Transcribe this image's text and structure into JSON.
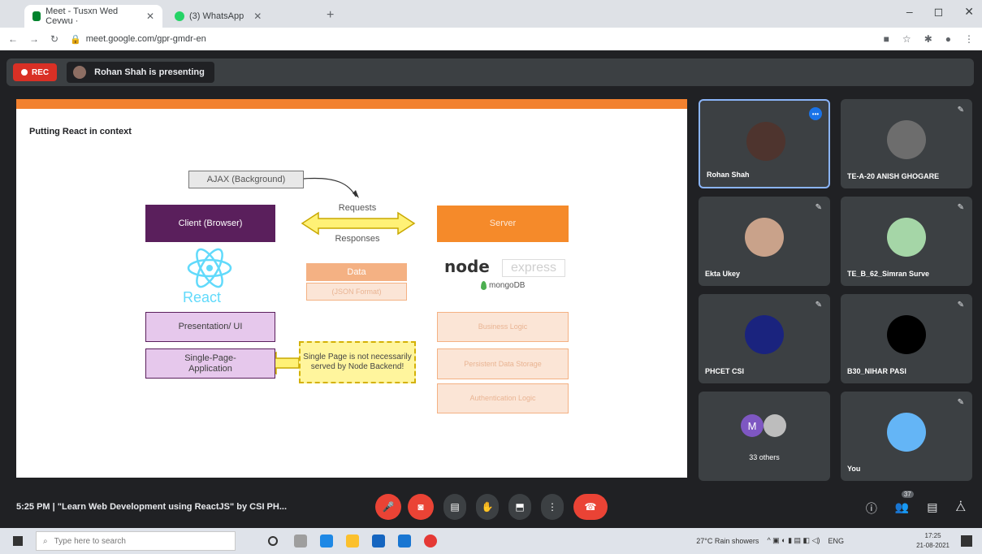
{
  "browser": {
    "tabs": [
      {
        "label": "Meet - Tusxn Wed Cevwu ·"
      },
      {
        "label": "(3) WhatsApp"
      }
    ],
    "new_tab": "+",
    "window_controls": [
      "–",
      "◻",
      "✕"
    ],
    "url": "meet.google.com/gpr-gmdr-en"
  },
  "meet": {
    "rec_label": "REC",
    "presenting_text": "Rohan Shah is presenting",
    "slide": {
      "title": "Putting React in context",
      "ajax": "AJAX (Background)",
      "client": "Client (Browser)",
      "server": "Server",
      "requests": "Requests",
      "responses": "Responses",
      "data": "Data",
      "json_format": "(JSON Format)",
      "react_label": "React",
      "node_label": "node",
      "express_label": "express",
      "mongo_label": "mongoDB",
      "presentation": "Presentation/ UI",
      "spa": "Single-Page-\nApplication",
      "note": "Single Page is not necessarily served by Node Backend!",
      "business": "Business Logic",
      "persistent": "Persistent Data Storage",
      "auth": "Authentication Logic",
      "colors": {
        "accent_bar": "#f2812f",
        "client": "#5a1f5c",
        "server": "#f58a2a"
      }
    },
    "participants": [
      {
        "name": "Rohan Shah",
        "highlighted": true
      },
      {
        "name": "TE-A-20 ANISH GHOGARE"
      },
      {
        "name": "Ekta Ukey"
      },
      {
        "name": "TE_B_62_Simran Surve"
      },
      {
        "name": "PHCET CSI"
      },
      {
        "name": "B30_NIHAR PASI"
      },
      {
        "name": "33 others"
      },
      {
        "name": "You"
      }
    ],
    "others_initial": "M",
    "meeting_info": "5:25 PM  |  \"Learn Web Development using ReactJS\" by CSI PH...",
    "participants_badge": "37"
  },
  "taskbar": {
    "search_placeholder": "Type here to search",
    "weather": "27°C  Rain showers",
    "lang": "ENG",
    "time": "17:25",
    "date": "21-08-2021"
  }
}
